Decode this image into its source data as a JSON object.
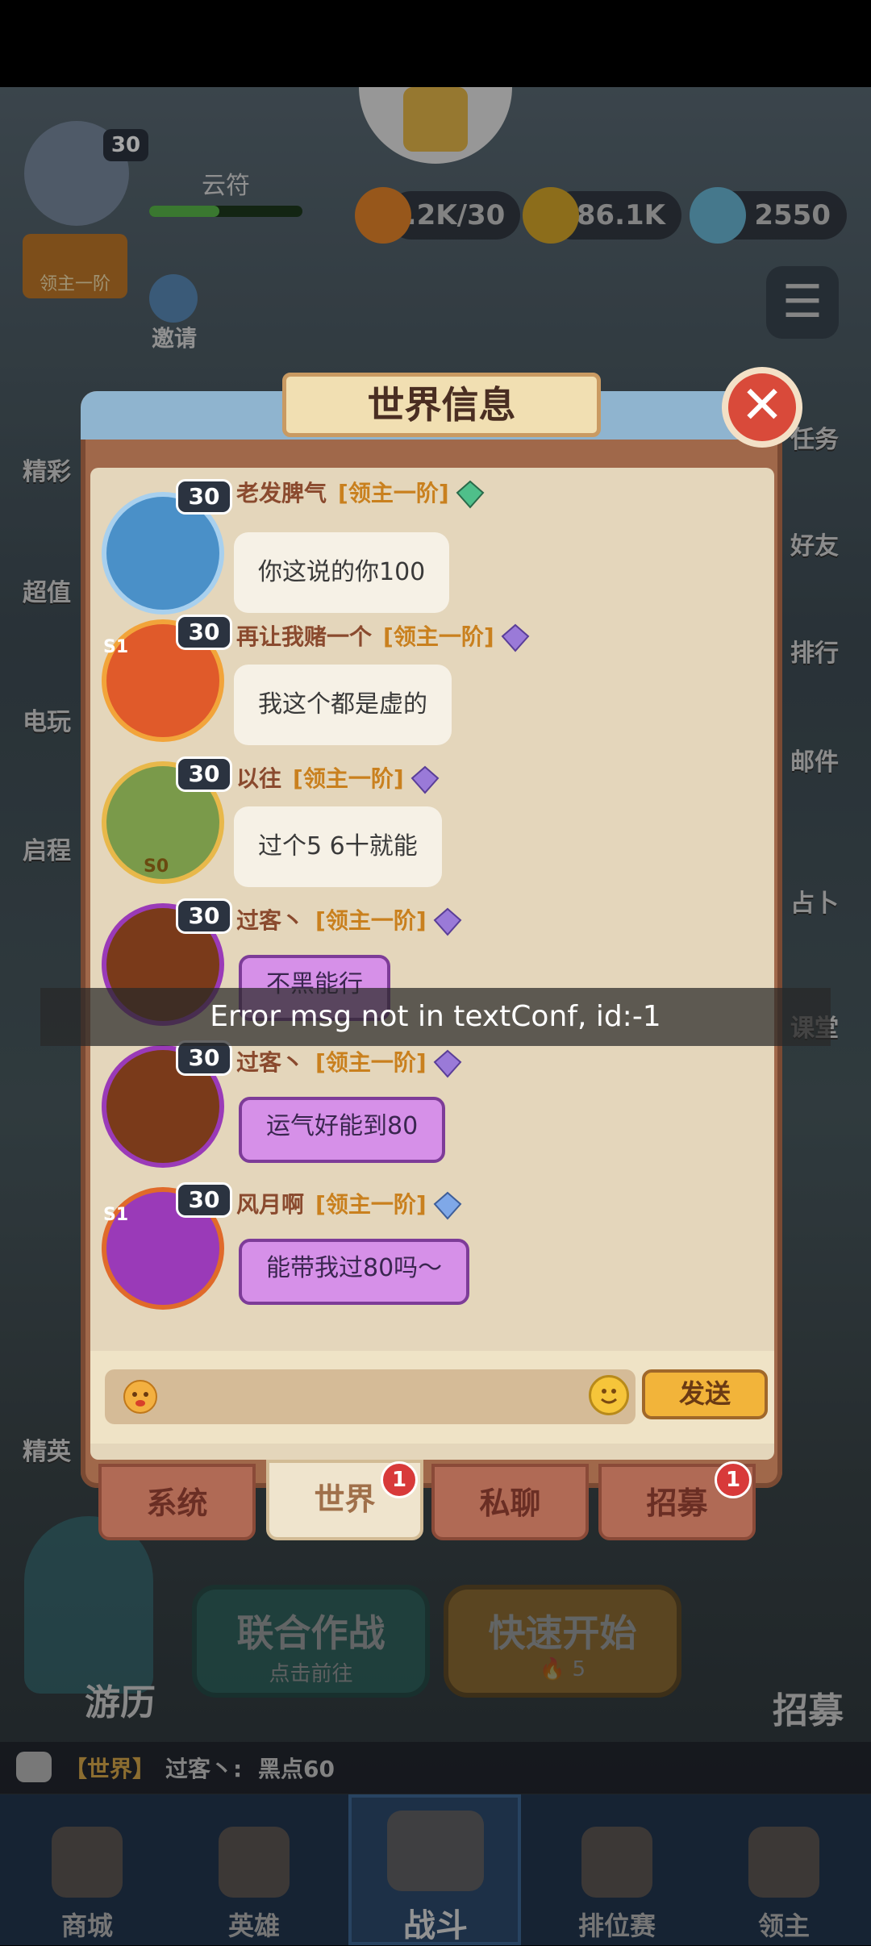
{
  "top_hud": {
    "player_level": "30",
    "player_name": "云符",
    "rank_label": "领主一阶",
    "invite_label": "邀请",
    "stamina": "3.2K/30",
    "gold": "86.1K",
    "gems": "2550"
  },
  "side_menu_left": [
    "精彩",
    "超值",
    "电玩",
    "启程",
    "精英"
  ],
  "side_menu_right": [
    "任务",
    "好友",
    "排行",
    "邮件",
    "占卜",
    "课堂"
  ],
  "modal": {
    "title": "世界信息",
    "close_icon": "close-x-icon"
  },
  "messages": [
    {
      "level": "30",
      "name": "老发脾气",
      "rank": "[领主一阶]",
      "text": "你这说的你100",
      "bubble": "plain",
      "season": "",
      "gem_color": "#4fbf8a"
    },
    {
      "level": "30",
      "name": "再让我赌一个",
      "rank": "[领主一阶]",
      "text": "我这个都是虚的",
      "bubble": "plain",
      "season": "S1",
      "gem_color": "#9a7ad8"
    },
    {
      "level": "30",
      "name": "以往",
      "rank": "[领主一阶]",
      "text": "过个5  6十就能",
      "bubble": "plain",
      "season": "S0",
      "gem_color": "#9a7ad8"
    },
    {
      "level": "30",
      "name": "过客丶",
      "rank": "[领主一阶]",
      "text": "不黑能行",
      "bubble": "purple",
      "season": "",
      "gem_color": "#9a7ad8"
    },
    {
      "level": "30",
      "name": "过客丶",
      "rank": "[领主一阶]",
      "text": "运气好能到80",
      "bubble": "purple",
      "season": "",
      "gem_color": "#9a7ad8"
    },
    {
      "level": "30",
      "name": "风月啊",
      "rank": "[领主一阶]",
      "text": "能带我过80吗～",
      "bubble": "purple",
      "season": "S1",
      "gem_color": "#7fa8e8"
    }
  ],
  "error_toast": "Error msg not in textConf, id:-1",
  "input": {
    "placeholder": "",
    "send_label": "发送"
  },
  "tabs": [
    {
      "label": "系统",
      "badge": ""
    },
    {
      "label": "世界",
      "badge": "1"
    },
    {
      "label": "私聊",
      "badge": ""
    },
    {
      "label": "招募",
      "badge": "1"
    }
  ],
  "scene_buttons": {
    "coop_title": "联合作战",
    "coop_sub": "点击前往",
    "quick_title": "快速开始",
    "quick_cost": "5",
    "travel_label": "游历",
    "recruit_label": "招募"
  },
  "chat_ticker": {
    "channel": "【世界】",
    "name": "过客丶:",
    "text": "黑点60"
  },
  "bottom_nav": [
    {
      "label": "商城"
    },
    {
      "label": "英雄"
    },
    {
      "label": "战斗"
    },
    {
      "label": "排位赛"
    },
    {
      "label": "领主"
    }
  ]
}
